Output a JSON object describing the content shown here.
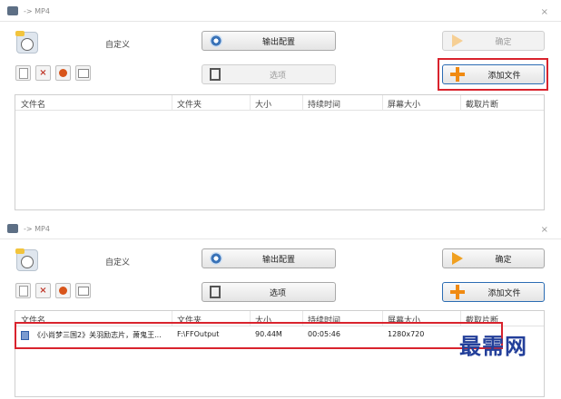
{
  "window": {
    "title": "-> MP4",
    "close": "×"
  },
  "profile": {
    "label": "自定义"
  },
  "buttons": {
    "output_config": "输出配置",
    "options": "选项",
    "ok": "确定",
    "add_file": "添加文件"
  },
  "columns": [
    "文件名",
    "文件夹",
    "大小",
    "持续时间",
    "屏幕大小",
    "截取片断"
  ],
  "files": [
    {
      "name": "《小尚梦三国2》关羽励志片，萧鬼王...",
      "folder": "F:\\FFOutput",
      "size": "90.44M",
      "duration": "00:05:46",
      "resolution": "1280x720",
      "clip": ""
    }
  ],
  "watermark": "最需网",
  "colors": {
    "highlight": "#d9232d",
    "watermark": "#233f9a"
  },
  "icons": {
    "profile": "phone-icon",
    "output": "disc-icon",
    "options": "film-icon",
    "ok": "arrow-right-icon",
    "add": "plus-icon"
  }
}
